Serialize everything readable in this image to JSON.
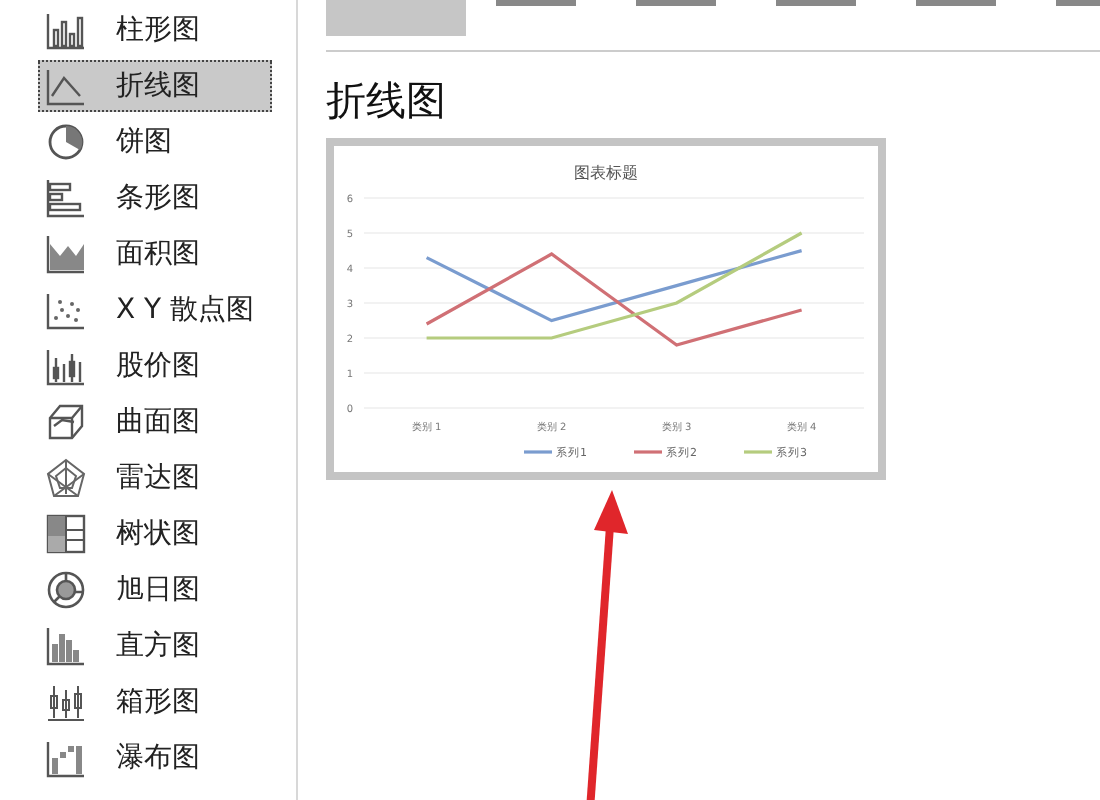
{
  "sidebar": {
    "items": [
      {
        "label": "柱形图",
        "kind": "column",
        "selected": false
      },
      {
        "label": "折线图",
        "kind": "line",
        "selected": true
      },
      {
        "label": "饼图",
        "kind": "pie",
        "selected": false
      },
      {
        "label": "条形图",
        "kind": "bar",
        "selected": false
      },
      {
        "label": "面积图",
        "kind": "area",
        "selected": false
      },
      {
        "label": "X Y 散点图",
        "kind": "scatter",
        "selected": false
      },
      {
        "label": "股价图",
        "kind": "stock",
        "selected": false
      },
      {
        "label": "曲面图",
        "kind": "surface",
        "selected": false
      },
      {
        "label": "雷达图",
        "kind": "radar",
        "selected": false
      },
      {
        "label": "树状图",
        "kind": "treemap",
        "selected": false
      },
      {
        "label": "旭日图",
        "kind": "sunburst",
        "selected": false
      },
      {
        "label": "直方图",
        "kind": "histogram",
        "selected": false
      },
      {
        "label": "箱形图",
        "kind": "box",
        "selected": false
      },
      {
        "label": "瀑布图",
        "kind": "waterfall",
        "selected": false
      }
    ]
  },
  "subtypes": [
    {
      "selected": true
    },
    {
      "selected": false
    },
    {
      "selected": false
    },
    {
      "selected": false
    },
    {
      "selected": false
    },
    {
      "selected": false
    }
  ],
  "heading": "折线图",
  "preview": {
    "chart_data": {
      "type": "line",
      "title": "图表标题",
      "categories": [
        "类别 1",
        "类别 2",
        "类别 3",
        "类别 4"
      ],
      "ylim": [
        0,
        6
      ],
      "grid": true,
      "legend": true,
      "yticks": [
        0,
        1,
        2,
        3,
        4,
        5,
        6
      ],
      "series": [
        {
          "name": "系列1",
          "color": "#7a9ccf",
          "values": [
            4.3,
            2.5,
            3.5,
            4.5
          ]
        },
        {
          "name": "系列2",
          "color": "#d07075",
          "values": [
            2.4,
            4.4,
            1.8,
            2.8
          ]
        },
        {
          "name": "系列3",
          "color": "#b5cc7e",
          "values": [
            2,
            2,
            3,
            5
          ]
        }
      ]
    }
  }
}
